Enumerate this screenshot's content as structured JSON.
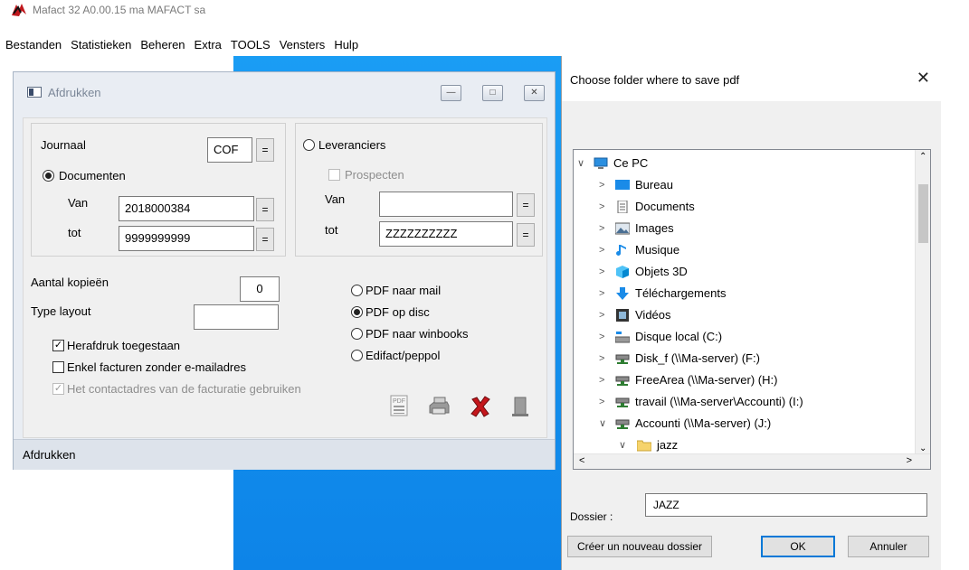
{
  "app": {
    "title": "Mafact 32 A0.00.15  ma MAFACT sa",
    "menu": [
      "Bestanden",
      "Statistieken",
      "Beheren",
      "Extra",
      "TOOLS",
      "Vensters",
      "Hulp"
    ]
  },
  "afdrukken": {
    "title": "Afdrukken",
    "journaal_label": "Journaal",
    "journaal_value": "COF",
    "documenten_label": "Documenten",
    "van_label": "Van",
    "van_value": "2018000384",
    "tot_label": "tot",
    "tot_value": "9999999999",
    "leveranciers_label": "Leveranciers",
    "prospecten_label": "Prospecten",
    "lev_van_label": "Van",
    "lev_van_value": "",
    "lev_tot_label": "tot",
    "lev_tot_value": "ZZZZZZZZZZ",
    "aantal_label": "Aantal kopieën",
    "aantal_value": "0",
    "type_layout_label": "Type layout",
    "type_layout_value": "",
    "herafdruk_label": "Herafdruk toegestaan",
    "enkel_label": "Enkel facturen zonder e-mailadres",
    "contact_label": "Het contactadres van de facturatie gebruiken",
    "pdf_mail_label": "PDF naar mail",
    "pdf_disc_label": "PDF op disc",
    "pdf_winbooks_label": "PDF naar winbooks",
    "edifact_label": "Edifact/peppol",
    "eq": "=",
    "status": "Afdrukken"
  },
  "folder_dialog": {
    "title": "Choose folder where to save pdf",
    "tree": [
      {
        "label": "Ce PC",
        "icon": "computer-icon",
        "arrow": "v",
        "level": 0
      },
      {
        "label": "Bureau",
        "icon": "desktop-icon",
        "arrow": ">",
        "level": 1
      },
      {
        "label": "Documents",
        "icon": "documents-icon",
        "arrow": ">",
        "level": 1
      },
      {
        "label": "Images",
        "icon": "images-icon",
        "arrow": ">",
        "level": 1
      },
      {
        "label": "Musique",
        "icon": "music-icon",
        "arrow": ">",
        "level": 1
      },
      {
        "label": "Objets 3D",
        "icon": "objects3d-icon",
        "arrow": ">",
        "level": 1
      },
      {
        "label": "Téléchargements",
        "icon": "downloads-icon",
        "arrow": ">",
        "level": 1
      },
      {
        "label": "Vidéos",
        "icon": "videos-icon",
        "arrow": ">",
        "level": 1
      },
      {
        "label": "Disque local (C:)",
        "icon": "local-disk-icon",
        "arrow": ">",
        "level": 1
      },
      {
        "label": "Disk_f (\\\\Ma-server) (F:)",
        "icon": "network-drive-icon",
        "arrow": ">",
        "level": 1
      },
      {
        "label": "FreeArea (\\\\Ma-server) (H:)",
        "icon": "network-drive-icon",
        "arrow": ">",
        "level": 1
      },
      {
        "label": "travail (\\\\Ma-server\\Accounti) (I:)",
        "icon": "network-drive-icon",
        "arrow": ">",
        "level": 1
      },
      {
        "label": "Accounti (\\\\Ma-server) (J:)",
        "icon": "network-drive-icon",
        "arrow": "v",
        "level": 1
      },
      {
        "label": "jazz",
        "icon": "folder-icon",
        "arrow": "v",
        "level": 2
      }
    ],
    "dossier_label": "Dossier :",
    "dossier_value": "JAZZ",
    "new_folder_label": "Créer un nouveau dossier",
    "ok_label": "OK",
    "cancel_label": "Annuler"
  }
}
